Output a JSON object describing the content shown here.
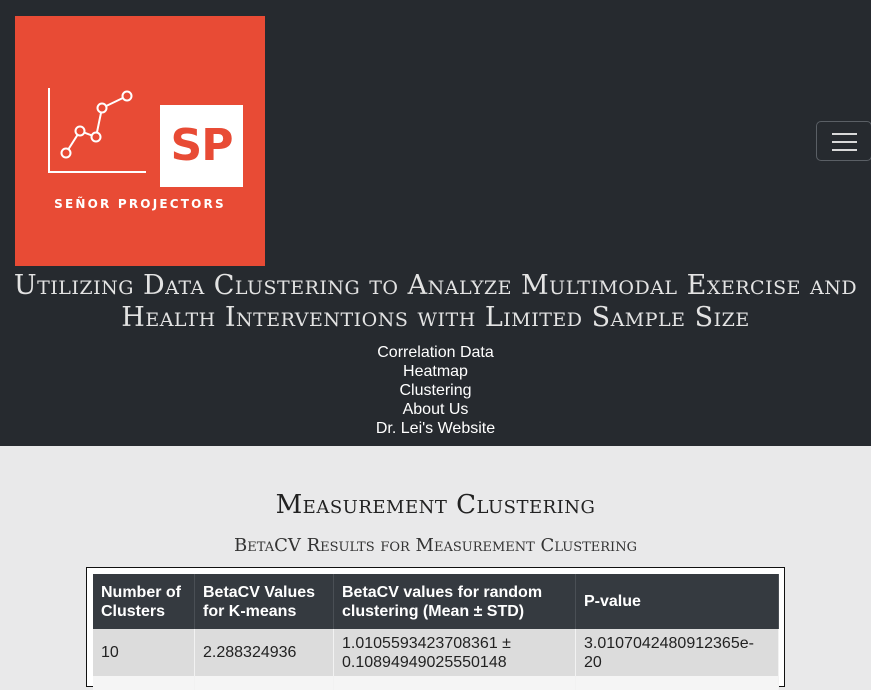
{
  "logo": {
    "initials": "SP",
    "name": "SEÑOR PROJECTORS",
    "brand_color": "#e84b35"
  },
  "header": {
    "title": "Utilizing Data Clustering to Analyze Multimodal Exercise and Health Interventions with Limited Sample Size",
    "menu_icon": "hamburger-icon",
    "nav": [
      {
        "label": "Correlation Data"
      },
      {
        "label": "Heatmap"
      },
      {
        "label": "Clustering"
      },
      {
        "label": "About Us"
      },
      {
        "label": "Dr. Lei's Website"
      }
    ]
  },
  "main": {
    "section_title": "Measurement Clustering",
    "table_caption": "BetaCV Results for Measurement Clustering",
    "table": {
      "headers": [
        "Number of Clusters",
        "BetaCV Values for K-means",
        "BetaCV values for random clustering (Mean ± STD)",
        "P-value"
      ],
      "rows": [
        [
          "10",
          "2.288324936",
          "1.0105593423708361 ± 0.10894949025550148",
          "3.0107042480912365e-20"
        ]
      ]
    }
  }
}
